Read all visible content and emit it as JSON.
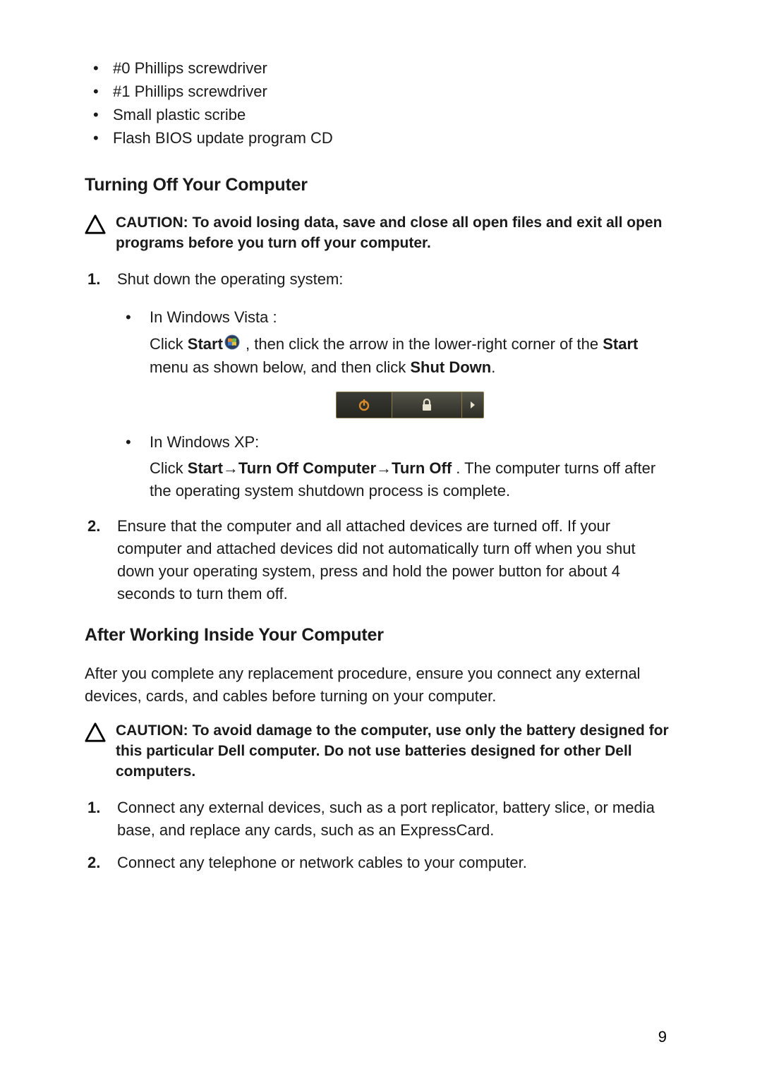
{
  "topBullets": [
    "#0 Phillips screwdriver",
    "#1 Phillips screwdriver",
    "Small plastic scribe",
    "Flash BIOS update program CD"
  ],
  "section1": {
    "heading": "Turning Off Your Computer",
    "caution": "CAUTION: To avoid losing data, save and close all open files and exit all open programs before you turn off your computer.",
    "step1": "Shut down the operating system:",
    "vista_label": "In Windows Vista :",
    "vista_p1a": "Click ",
    "vista_p1_start": "Start",
    "vista_p1b": " , then click the arrow in the lower-right corner of the ",
    "vista_p1_start2": "Start",
    "vista_p1c": " menu as shown below, and then click ",
    "vista_p1_shutdown": "Shut Down",
    "vista_p1d": ".",
    "xp_label": "In Windows XP:",
    "xp_a": "Click ",
    "xp_start": "Start",
    "xp_arrow1": " → ",
    "xp_turnoffcomp": "Turn Off Computer",
    "xp_arrow2": " → ",
    "xp_turnoff": "Turn Off",
    "xp_b": " . The computer turns off after the operating system shutdown process is complete.",
    "step2": "Ensure that the computer and all attached devices are turned off. If your computer and attached devices did not automatically turn off when you shut down your operating system, press and hold the power button for about 4 seconds to turn them off."
  },
  "section2": {
    "heading": "After Working Inside Your Computer",
    "intro": "After you complete any replacement procedure, ensure you connect any external devices, cards, and cables before turning on your computer.",
    "caution": "CAUTION: To avoid damage to the computer, use only the battery designed for this particular Dell computer. Do not use batteries designed for other Dell computers.",
    "step1": "Connect any external devices, such as a port replicator, battery slice, or media base, and replace any cards, such as an ExpressCard.",
    "step2": "Connect any telephone or network cables to your computer."
  },
  "pageNumber": "9"
}
